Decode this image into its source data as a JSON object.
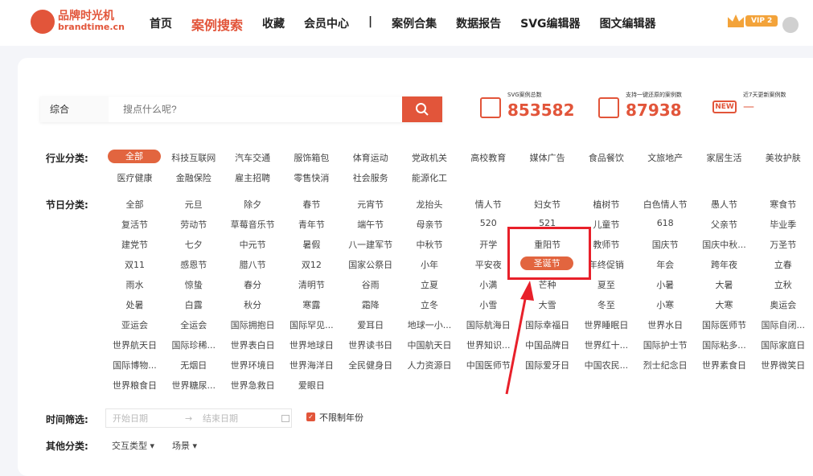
{
  "brand": {
    "name": "品牌时光机",
    "domain": "brandtime.cn"
  },
  "nav": {
    "items": [
      "首页",
      "案例搜索",
      "收藏",
      "会员中心",
      "|",
      "案例合集",
      "数据报告",
      "SVG编辑器",
      "图文编辑器"
    ],
    "active": 1,
    "vip": "VIP 2"
  },
  "search": {
    "type": "综合",
    "placeholder": "搜点什么呢?"
  },
  "stats": [
    {
      "label": "SVG案例总数",
      "value": "853582",
      "icon": "search-doc-icon"
    },
    {
      "label": "支持一键还原的案例数",
      "value": "87938",
      "icon": "restore-icon"
    },
    {
      "label": "近7天更新案例数",
      "value": "—",
      "icon": "NEW"
    }
  ],
  "industry": {
    "label": "行业分类:",
    "items": [
      "全部",
      "科技互联网",
      "汽车交通",
      "服饰箱包",
      "体育运动",
      "党政机关",
      "高校教育",
      "媒体广告",
      "食品餐饮",
      "文旅地产",
      "家居生活",
      "美妆护肤",
      "医疗健康",
      "金融保险",
      "雇主招聘",
      "零售快消",
      "社会服务",
      "能源化工"
    ],
    "selected": 0
  },
  "festival": {
    "label": "节日分类:",
    "items": [
      "全部",
      "元旦",
      "除夕",
      "春节",
      "元宵节",
      "龙抬头",
      "情人节",
      "妇女节",
      "植树节",
      "白色情人节",
      "愚人节",
      "寒食节",
      "复活节",
      "劳动节",
      "草莓音乐节",
      "青年节",
      "端午节",
      "母亲节",
      "520",
      "521",
      "儿童节",
      "618",
      "父亲节",
      "毕业季",
      "建党节",
      "七夕",
      "中元节",
      "暑假",
      "八一建军节",
      "中秋节",
      "开学",
      "重阳节",
      "教师节",
      "国庆节",
      "国庆中秋...",
      "万圣节",
      "双11",
      "感恩节",
      "腊八节",
      "双12",
      "国家公祭日",
      "小年",
      "平安夜",
      "圣诞节",
      "年终促销",
      "年会",
      "跨年夜",
      "立春",
      "雨水",
      "惊蛰",
      "春分",
      "清明节",
      "谷雨",
      "立夏",
      "小满",
      "芒种",
      "夏至",
      "小暑",
      "大暑",
      "立秋",
      "处暑",
      "白露",
      "秋分",
      "寒露",
      "霜降",
      "立冬",
      "小雪",
      "大雪",
      "冬至",
      "小寒",
      "大寒",
      "奥运会",
      "亚运会",
      "全运会",
      "国际拥抱日",
      "国际罕见...",
      "爱耳日",
      "地球一小...",
      "国际航海日",
      "国际幸福日",
      "世界睡眠日",
      "世界水日",
      "国际医师节",
      "国际自闭...",
      "世界航天日",
      "国际珍稀...",
      "世界表白日",
      "世界地球日",
      "世界读书日",
      "中国航天日",
      "世界知识...",
      "中国品牌日",
      "世界红十...",
      "国际护士节",
      "国际粘多...",
      "国际家庭日",
      "国际博物...",
      "无烟日",
      "世界环境日",
      "世界海洋日",
      "全民健身日",
      "人力资源日",
      "中国医师节",
      "国际爱牙日",
      "中国农民...",
      "烈士纪念日",
      "世界素食日",
      "世界微笑日",
      "世界粮食日",
      "世界糖尿...",
      "世界急救日",
      "爱眼日"
    ],
    "selected": 43
  },
  "time": {
    "label": "时间筛选:",
    "start": "开始日期",
    "arrow": "→",
    "end": "结束日期",
    "checkbox": "不限制年份",
    "checked": true
  },
  "other": {
    "label": "其他分类:",
    "dropdowns": [
      "交互类型 ▾",
      "场景 ▾"
    ]
  },
  "colors": {
    "accent": "#e2553a",
    "annotation": "#e8202a"
  }
}
